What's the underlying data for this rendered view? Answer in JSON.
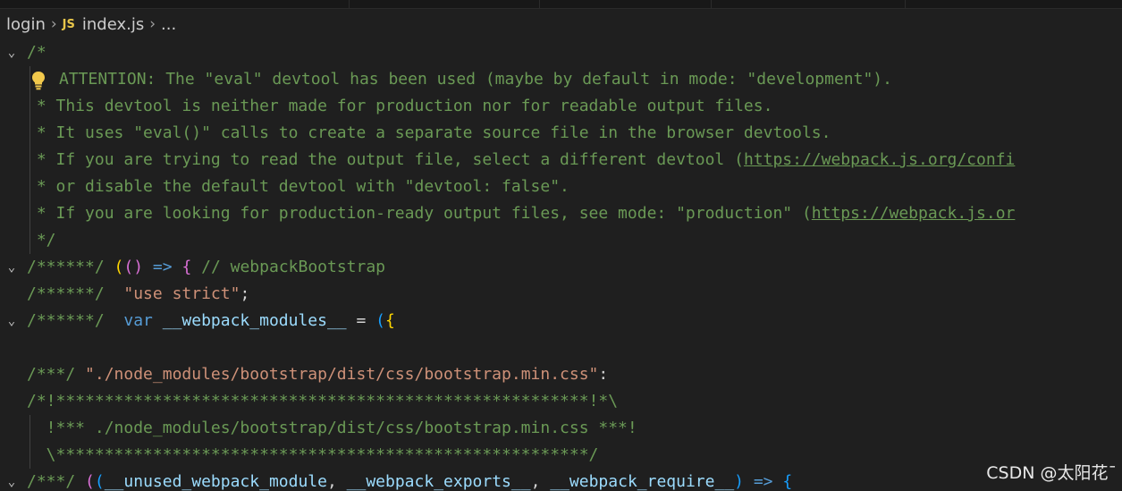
{
  "breadcrumb": {
    "folder": "login",
    "file_icon": "JS",
    "file": "index.js",
    "tail": "..."
  },
  "code": {
    "l1": "/*",
    "l2": "ATTENTION: The \"eval\" devtool has been used (maybe by default in mode: \"development\").",
    "l3": " * This devtool is neither made for production nor for readable output files.",
    "l4": " * It uses \"eval()\" calls to create a separate source file in the browser devtools.",
    "l5_text": " * If you are trying to read the output file, select a different devtool (",
    "l5_url": "https://webpack.js.org/confi",
    "l6": " * or disable the default devtool with \"devtool: false\".",
    "l7_text": " * If you are looking for production-ready output files, see mode: \"production\" (",
    "l7_url": "https://webpack.js.or",
    "l8": " */",
    "l9_comment": "/******/ ",
    "l9_paren": "(",
    "l9_inner": "()",
    "l9_arrow": " => ",
    "l9_brace": "{",
    "l9_tail": " // webpackBootstrap",
    "l10_comment": "/******/ ",
    "l10_str": " \"use strict\"",
    "l10_semi": ";",
    "l11_comment": "/******/ ",
    "l11_kw": " var ",
    "l11_var": "__webpack_modules__",
    "l11_eq": " = ",
    "l11_paren": "(",
    "l11_brace": "{",
    "l13_comment": "/***/ ",
    "l13_str": "\"./node_modules/bootstrap/dist/css/bootstrap.min.css\"",
    "l13_colon": ":",
    "l14": "/*!*******************************************************!*\\",
    "l15": "  !*** ./node_modules/bootstrap/dist/css/bootstrap.min.css ***!",
    "l16": "  \\*******************************************************/",
    "l17_comment": "/***/ ",
    "l17_paren": "(",
    "l17_inner": "(",
    "l17_p1": "__unused_webpack_module",
    "l17_c1": ", ",
    "l17_p2": "__webpack_exports__",
    "l17_c2": ", ",
    "l17_p3": "__webpack_require__",
    "l17_close": ")",
    "l17_arrow": " => ",
    "l17_brace": "{"
  },
  "watermark": "CSDN @太阳花ˉ",
  "colors": {
    "background": "#1f1f1f",
    "comment": "#6a9955",
    "keyword": "#569cd6",
    "string": "#ce9178",
    "variable": "#9cdcfe",
    "bracket_gold": "#ffd700",
    "bracket_purple": "#da70d6",
    "bracket_blue": "#179fff"
  },
  "icons": [
    "chevron-right-icon",
    "js-file-icon",
    "lightbulb-icon",
    "fold-chevron-down-icon"
  ]
}
